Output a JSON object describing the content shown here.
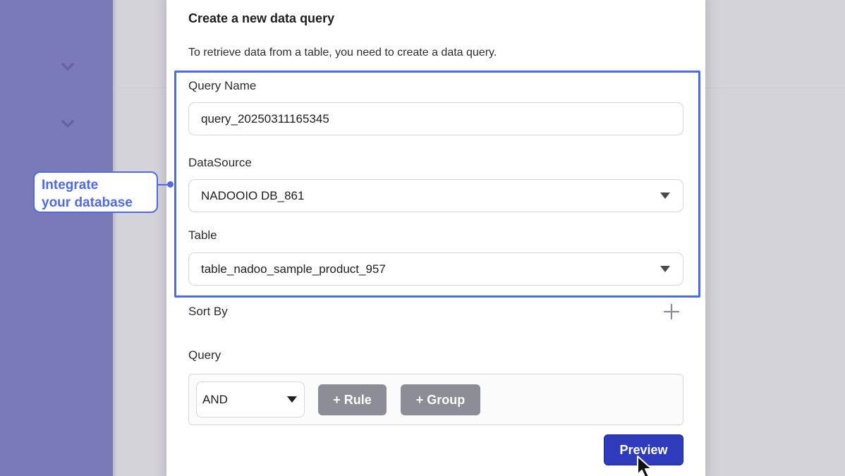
{
  "modal": {
    "title": "Create a new data query",
    "description": "To retrieve data from a table, you need to create a data query.",
    "query_name": {
      "label": "Query Name",
      "value": "query_20250311165345"
    },
    "datasource": {
      "label": "DataSource",
      "value": "NADOOIO DB_861"
    },
    "table": {
      "label": "Table",
      "value": "table_nadoo_sample_product_957"
    },
    "sort_by": {
      "label": "Sort By",
      "add_icon": "plus-icon"
    },
    "query": {
      "label": "Query",
      "combinator": "AND",
      "add_rule_label": "+ Rule",
      "add_group_label": "+ Group"
    },
    "preview_label": "Preview"
  },
  "annotation": {
    "callout_line1": "Integrate",
    "callout_line2": "your database",
    "accent_color": "#4e6ae8"
  },
  "colors": {
    "sidebar": "#7b7ab8",
    "primary_button": "#2f3bbd",
    "secondary_button": "#8c8d96"
  }
}
